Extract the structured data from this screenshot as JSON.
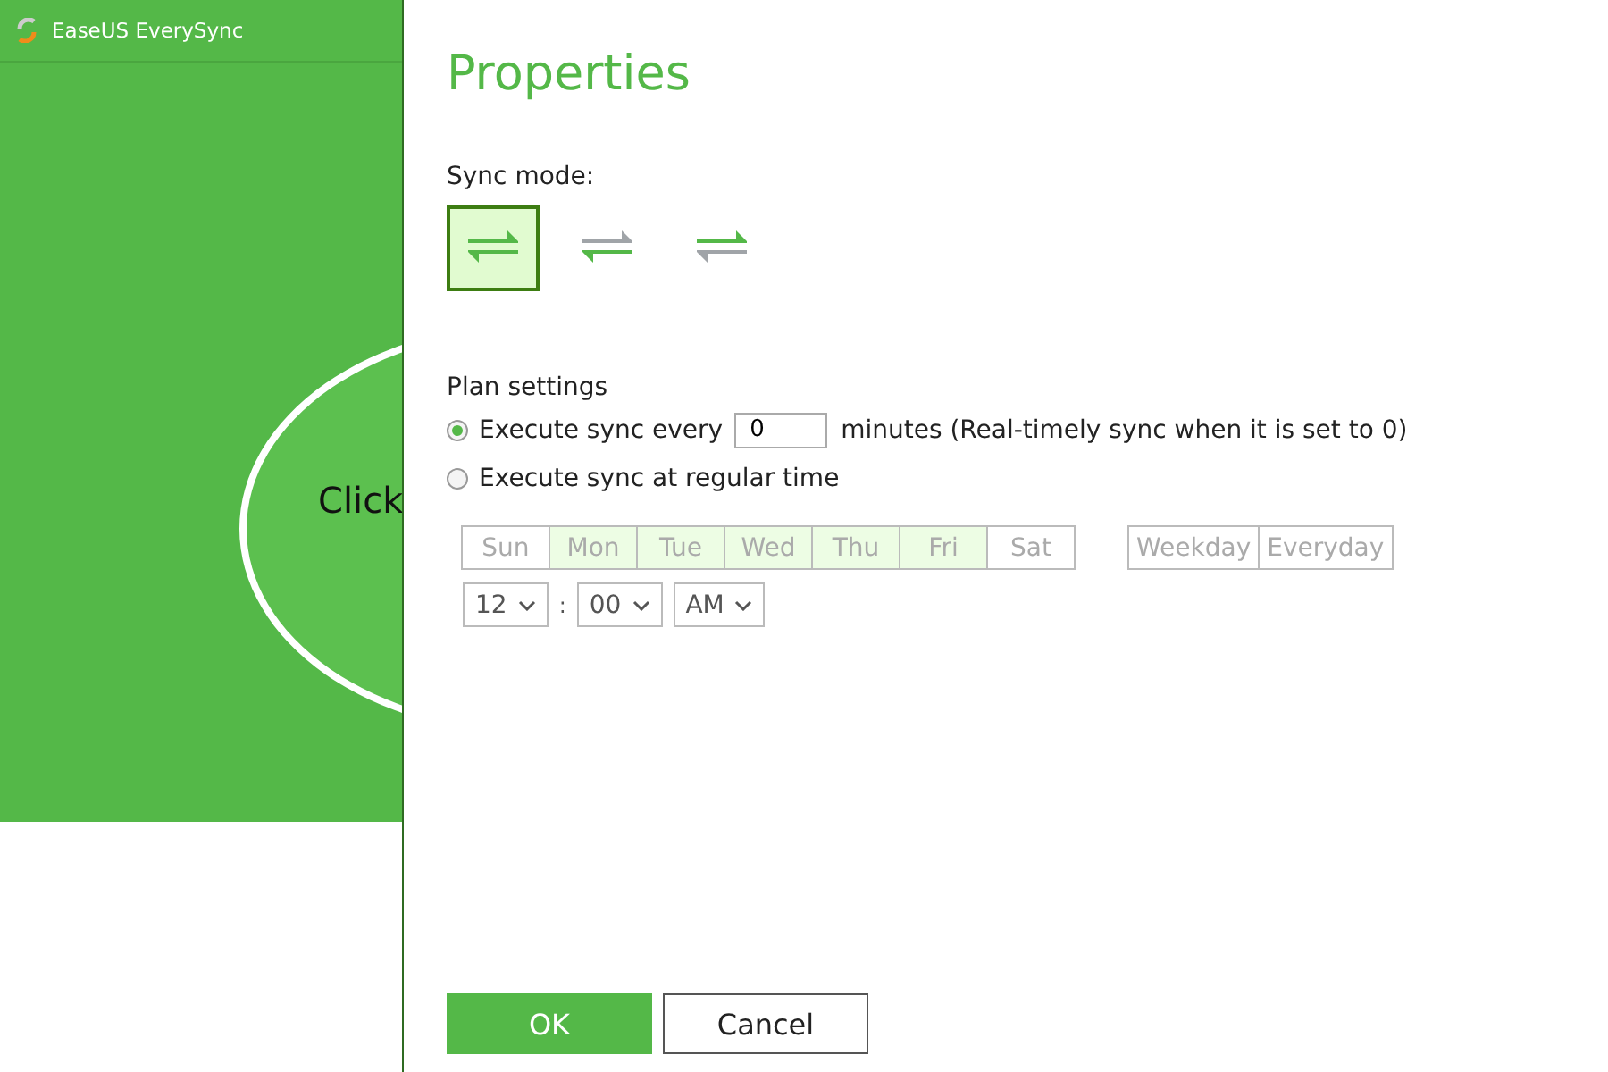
{
  "app": {
    "title": "EaseUS EverySync",
    "circle_text": "Click"
  },
  "dialog": {
    "title": "Properties",
    "sync_mode_label": "Sync mode:",
    "sync_modes": [
      {
        "kind": "two-way",
        "selected": true
      },
      {
        "kind": "to-left",
        "selected": false
      },
      {
        "kind": "to-right",
        "selected": false
      }
    ],
    "plan_label": "Plan settings",
    "options": [
      {
        "kind": "interval",
        "label": "Execute sync every",
        "selected": true,
        "value": "0",
        "suffix": "minutes (Real-timely sync when it is set to 0)"
      },
      {
        "kind": "regular",
        "label": "Execute sync at regular time",
        "selected": false
      }
    ],
    "days": [
      {
        "label": "Sun",
        "selected": false
      },
      {
        "label": "Mon",
        "selected": true
      },
      {
        "label": "Tue",
        "selected": true
      },
      {
        "label": "Wed",
        "selected": true
      },
      {
        "label": "Thu",
        "selected": true
      },
      {
        "label": "Fri",
        "selected": true
      },
      {
        "label": "Sat",
        "selected": false
      }
    ],
    "presets": [
      "Weekday",
      "Everyday"
    ],
    "time": {
      "hour": "12",
      "separator": ":",
      "minute": "00",
      "period": "AM"
    },
    "buttons": [
      {
        "label": "OK",
        "kind": "primary"
      },
      {
        "label": "Cancel",
        "kind": "secondary"
      }
    ]
  }
}
